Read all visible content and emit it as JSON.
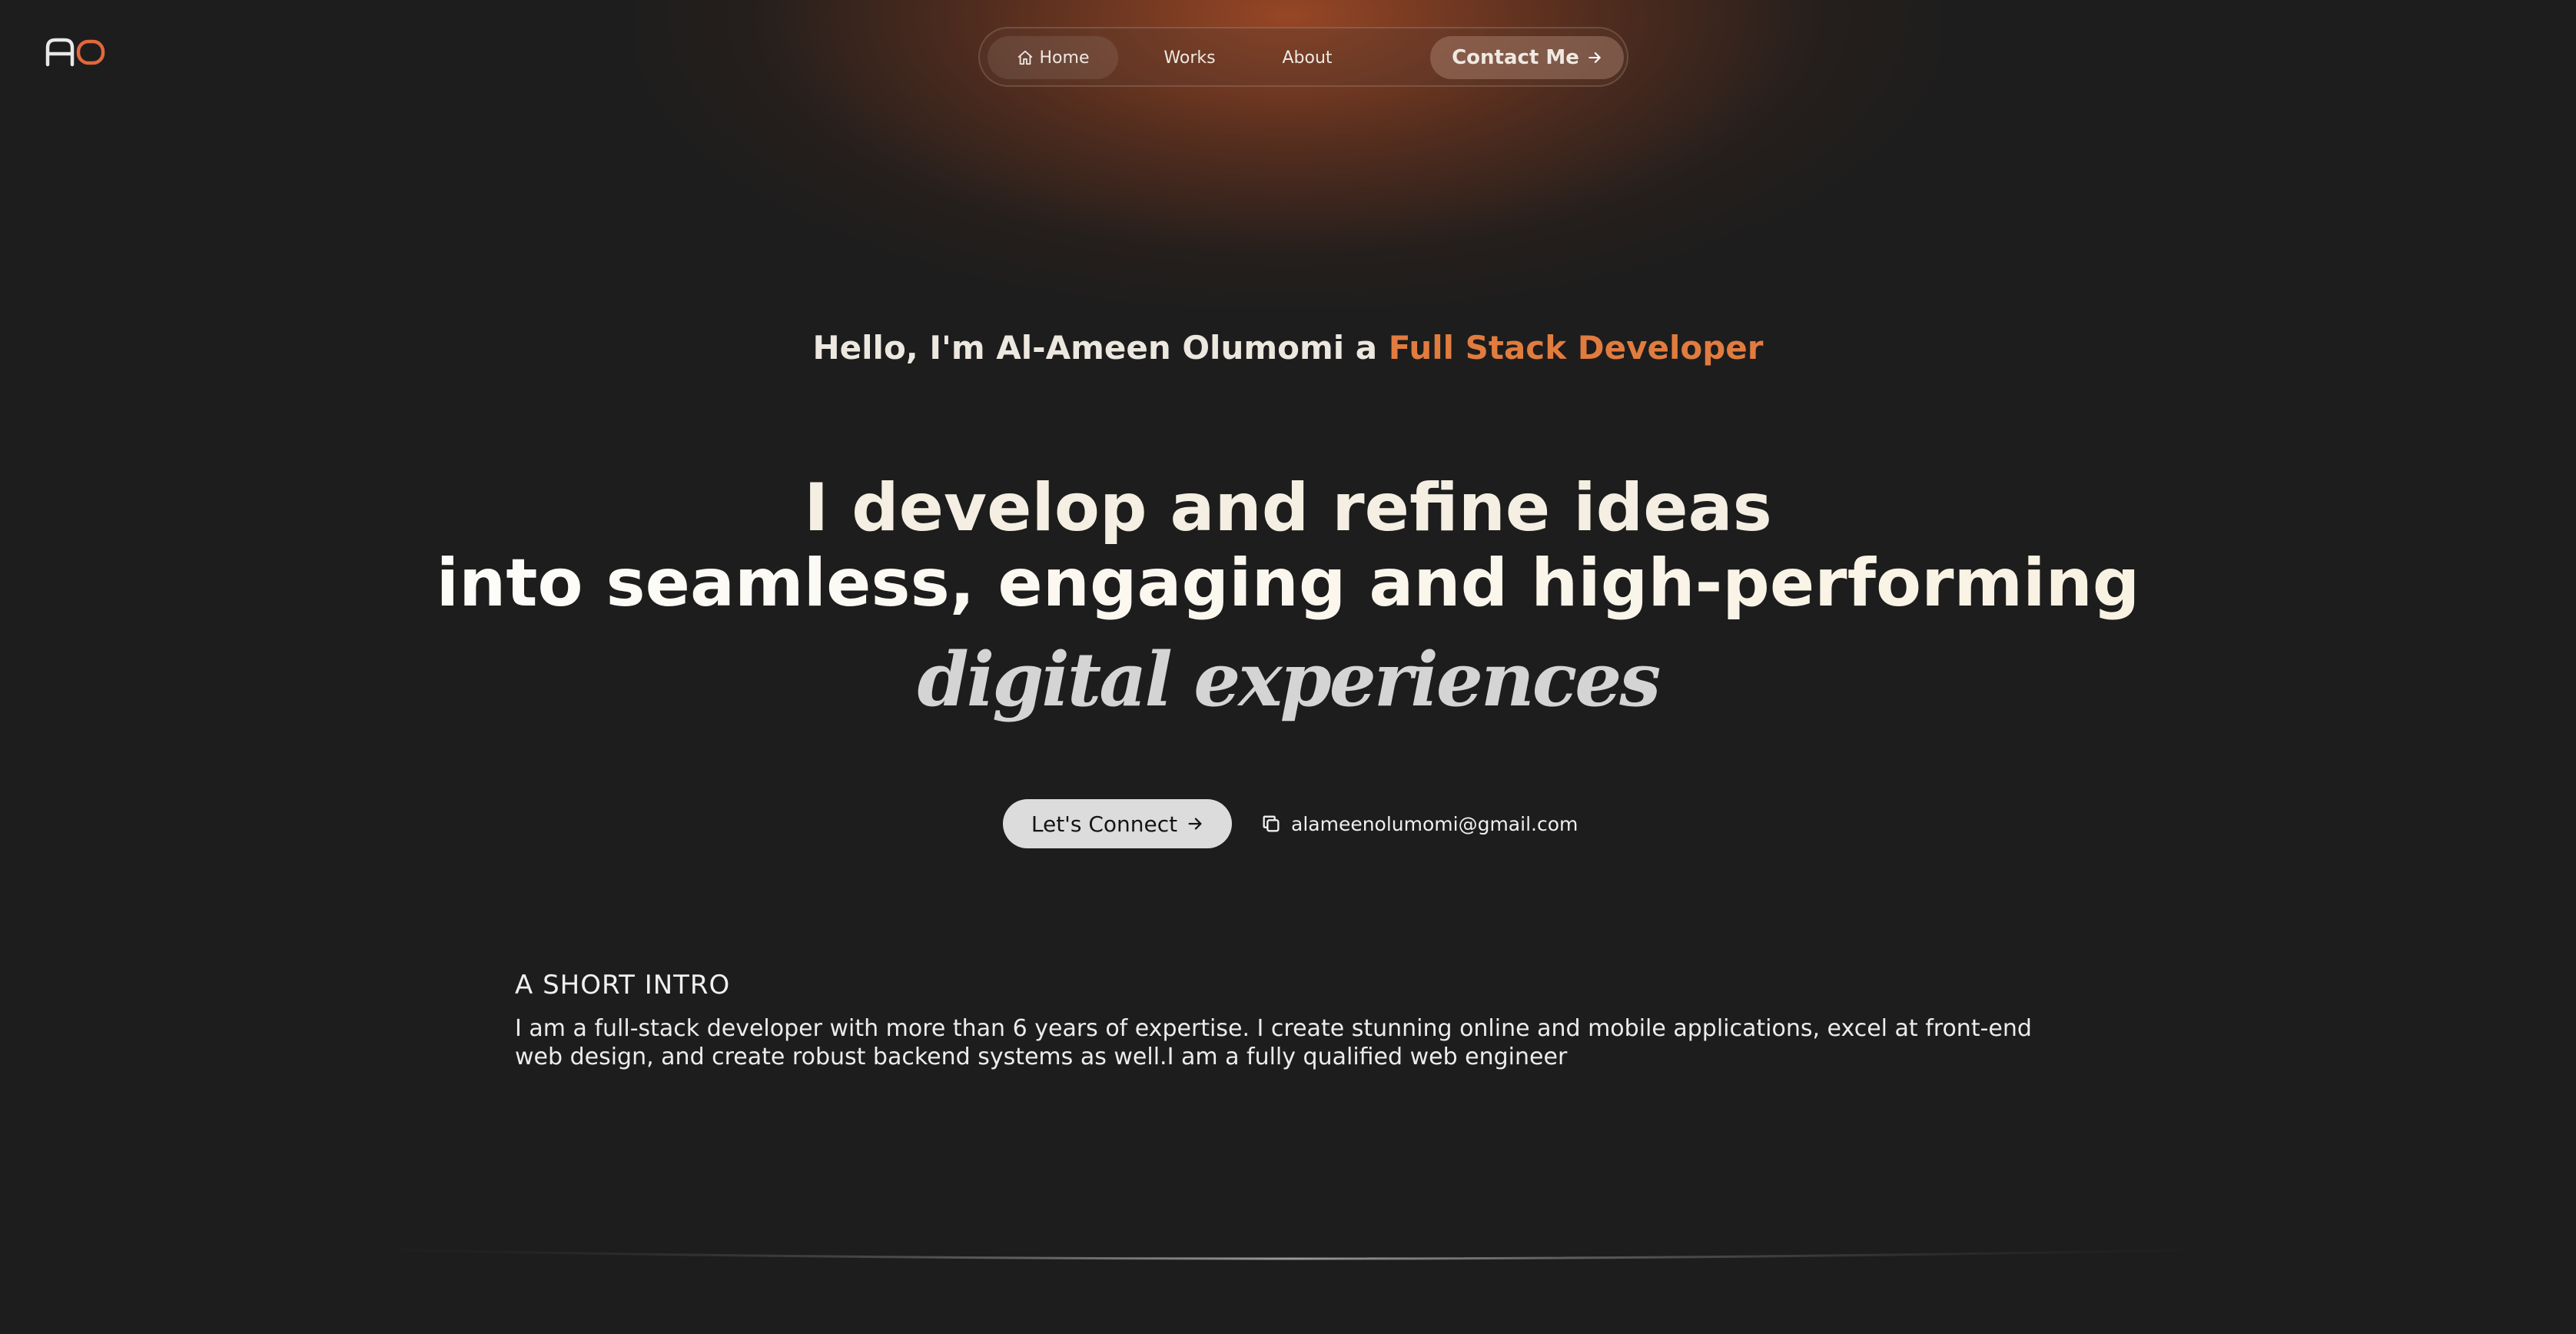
{
  "logo": {
    "text": "AO",
    "colors": {
      "a": "#e8e8e8",
      "o": "#e2683a"
    }
  },
  "nav": {
    "items": [
      {
        "label": "Home",
        "icon": "home-icon"
      },
      {
        "label": "Works"
      },
      {
        "label": "About"
      }
    ],
    "contact_label": "Contact Me",
    "contact_icon": "arrow-right-icon"
  },
  "hero": {
    "greeting_prefix": "Hello, I'm Al-Ameen Olumomi a",
    "greeting_role": "Full Stack Developer",
    "headline_line1": "I develop and refine ideas",
    "headline_line2": "into seamless, engaging and high-performing",
    "headline_script": "digital experiences",
    "connect_label": "Let's Connect",
    "connect_icon": "arrow-right-icon",
    "email": "alameenolumomi@gmail.com",
    "email_icon": "copy-icon"
  },
  "intro": {
    "heading": "A SHORT INTRO",
    "text": "I am a full-stack developer with more than 6 years of expertise. I create stunning online and mobile applications, excel at front-end web design, and create robust backend systems as well.I am a fully qualified web engineer"
  },
  "colors": {
    "background": "#1d1d1d",
    "accent": "#e17c3f",
    "glow": "#b95228"
  }
}
